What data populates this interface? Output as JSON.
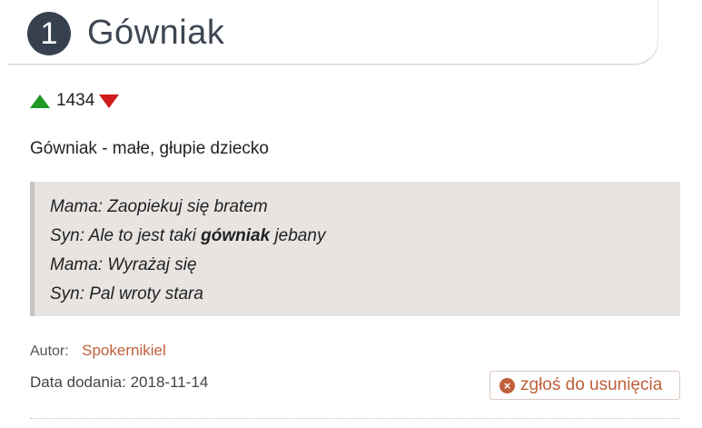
{
  "entry": {
    "rank": "1",
    "title": "Gówniak"
  },
  "votes": {
    "count": "1434",
    "up_color": "#1f9a26",
    "down_color": "#d01c1c",
    "up_icon": "triangle-up-icon",
    "down_icon": "triangle-down-icon"
  },
  "definition": "Gówniak - małe, głupie dziecko",
  "example": {
    "lines": [
      {
        "text": "Mama: Zaopiekuj się bratem"
      },
      {
        "before": "Syn: Ale to jest taki ",
        "bold": "gówniak",
        "after": " jebany"
      },
      {
        "text": "Mama: Wyrażaj się"
      },
      {
        "text": "Syn: Pal wroty stara"
      }
    ]
  },
  "author": {
    "label": "Autor:",
    "name": "Spokernikiel"
  },
  "date": {
    "text": "Data dodania: 2018-11-14"
  },
  "report": {
    "label": "zgłoś do usunięcia",
    "icon": "close-circle-icon",
    "icon_glyph": "×",
    "accent": "#c0603a"
  }
}
